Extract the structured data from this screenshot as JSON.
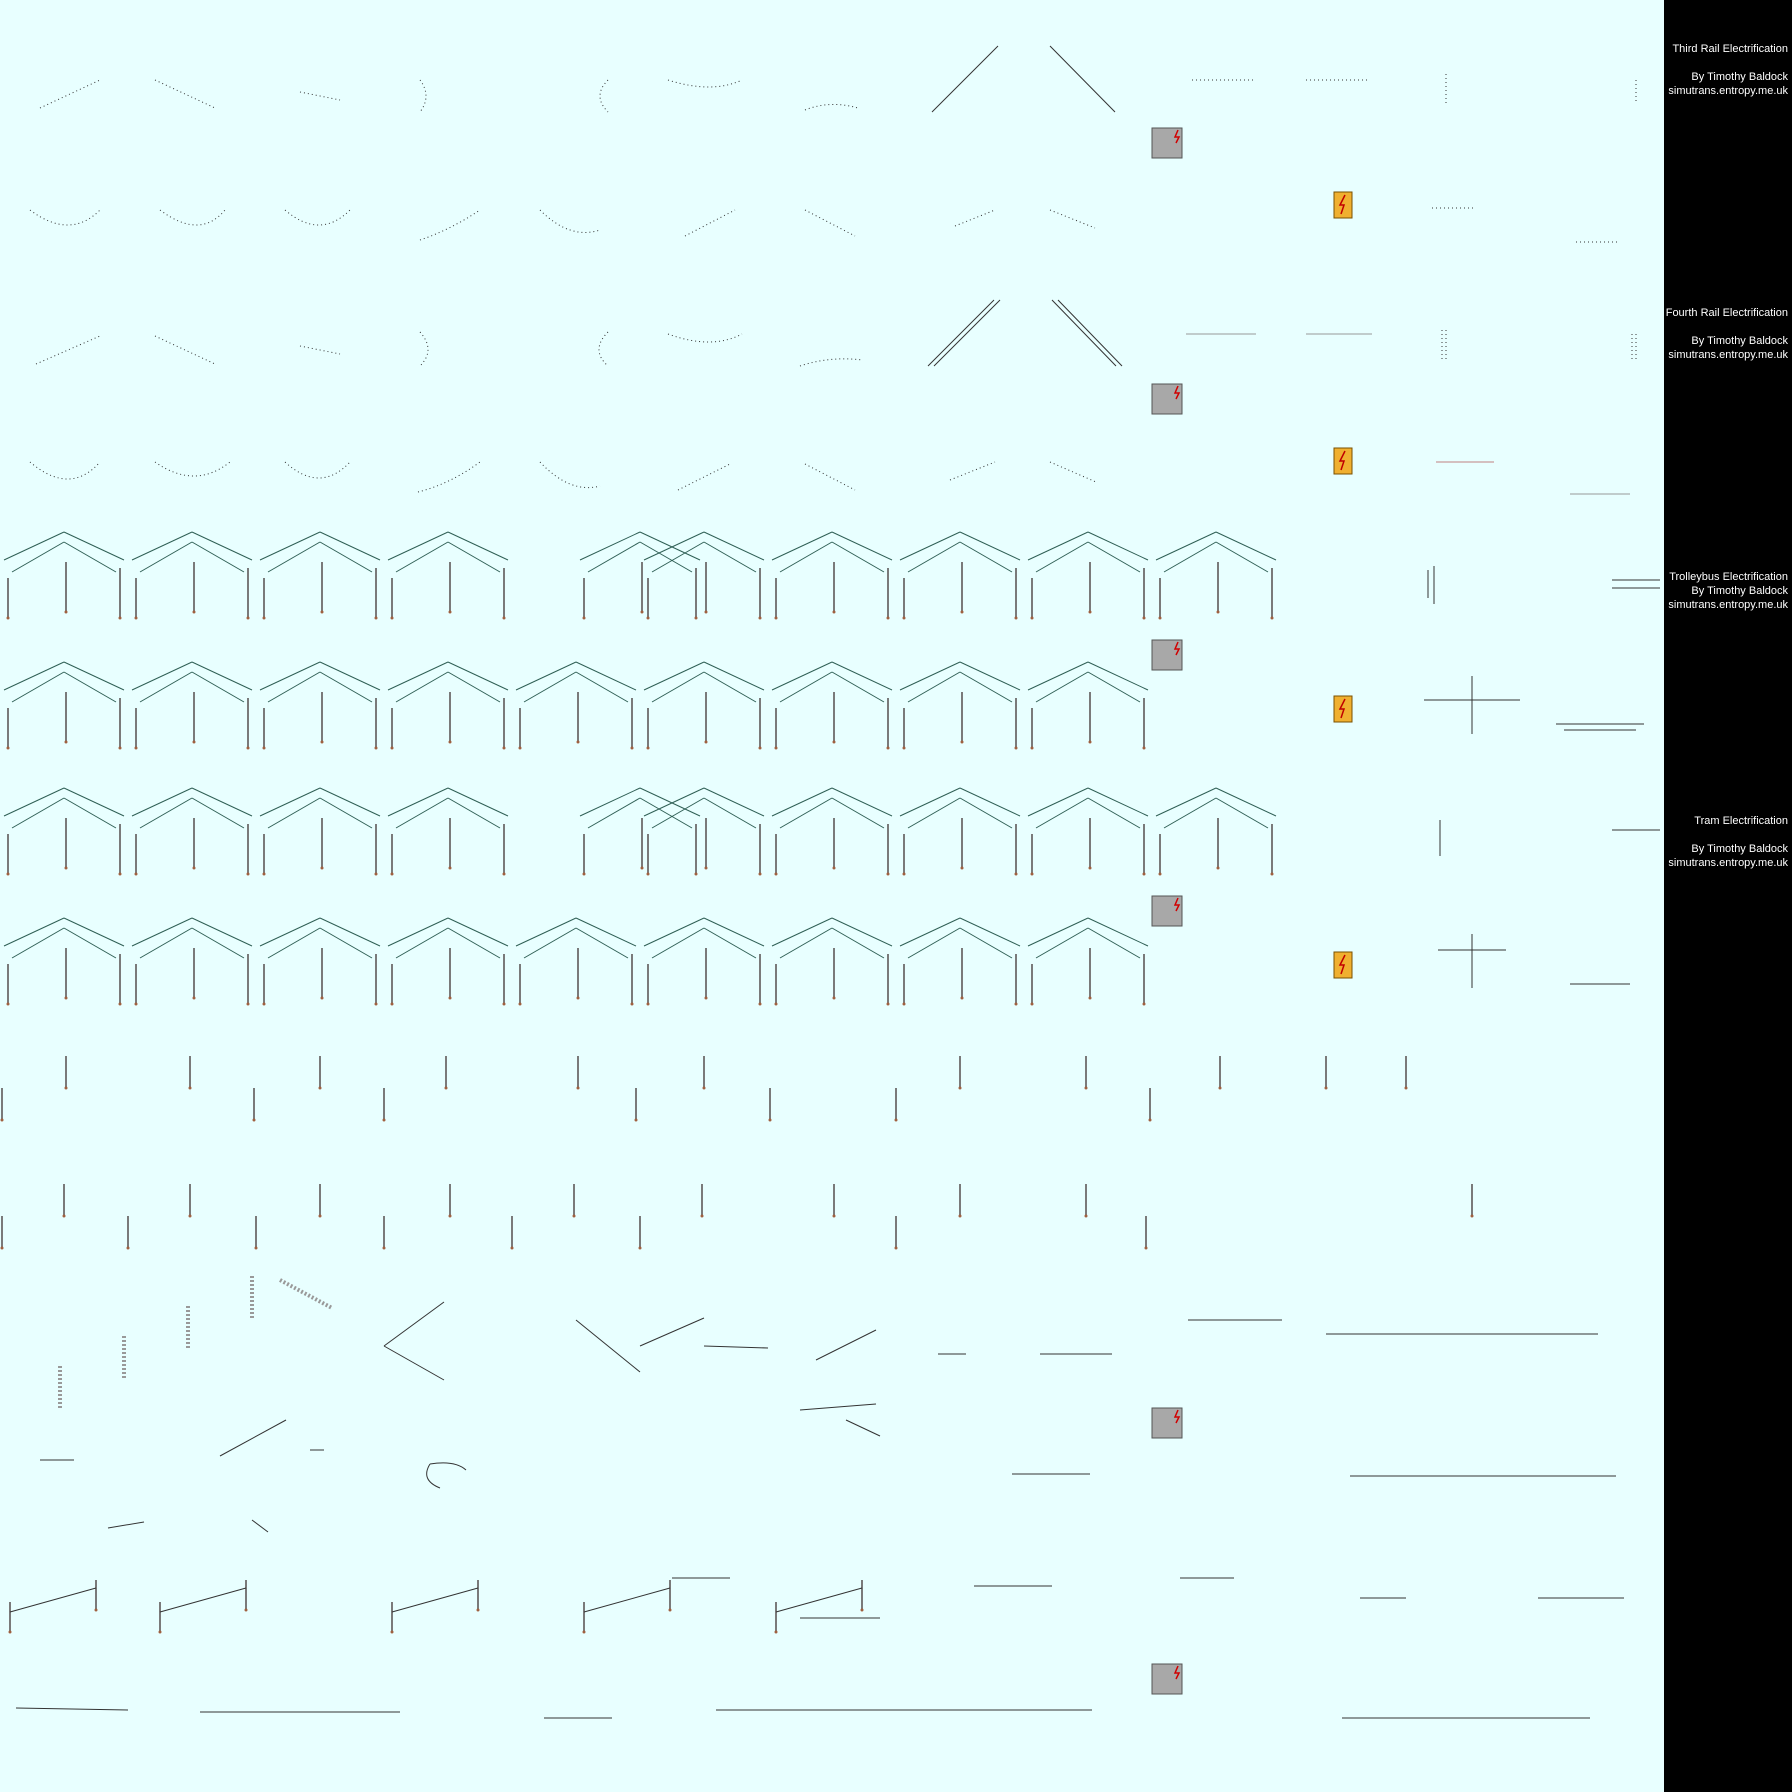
{
  "credits": [
    {
      "title": "Third Rail Electrification",
      "author": "By Timothy Baldock",
      "url": "simutrans.entropy.me.uk"
    },
    {
      "title": "Fourth Rail Electrification",
      "author": "By Timothy Baldock",
      "url": "simutrans.entropy.me.uk"
    },
    {
      "title": "Trolleybus Electrification",
      "author": "By Timothy Baldock",
      "url": "simutrans.entropy.me.uk"
    },
    {
      "title": "Tram Electrification",
      "author": "By Timothy Baldock",
      "url": "simutrans.entropy.me.uk"
    }
  ],
  "colors": {
    "background": "#e8ffff",
    "panel": "#000000",
    "wire": "#333333",
    "pole": "#7a7a7a",
    "catenary": "#2f5f55",
    "icon_gold": "#f0b030",
    "icon_grey": "#a8a8a8"
  },
  "sections": [
    {
      "name": "third-rail",
      "icons": [
        "catalog-icon",
        "electric-sign-icon"
      ]
    },
    {
      "name": "fourth-rail",
      "icons": [
        "catalog-icon",
        "electric-sign-icon"
      ]
    },
    {
      "name": "trolleybus",
      "icons": [
        "catalog-icon",
        "electric-sign-icon"
      ]
    },
    {
      "name": "tram",
      "icons": [
        "catalog-icon",
        "electric-sign-icon"
      ]
    },
    {
      "name": "masts",
      "icons": []
    },
    {
      "name": "misc-parts",
      "icons": [
        "plain-icon",
        "plain-icon"
      ]
    }
  ]
}
